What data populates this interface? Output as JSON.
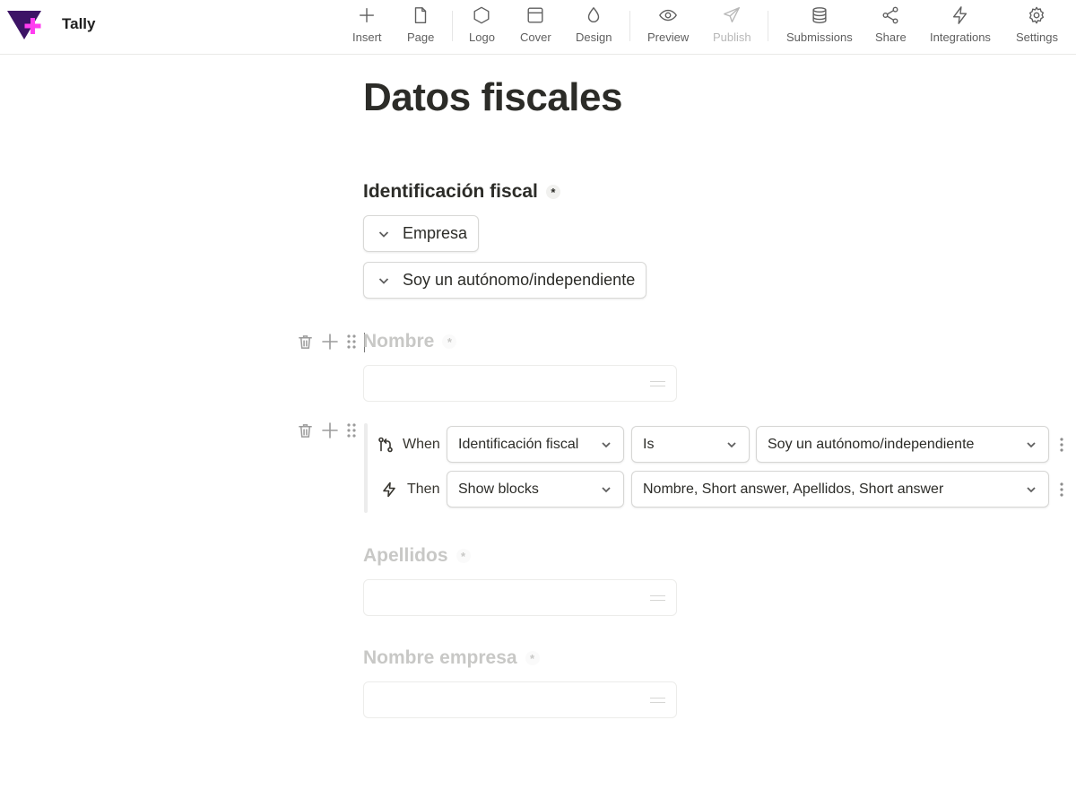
{
  "app": {
    "name": "Tally",
    "logo_colors": {
      "triangle": "#3d1466",
      "plus": "#ff3df0"
    }
  },
  "toolbar": {
    "items": [
      {
        "label": "Insert",
        "icon": "plus-icon"
      },
      {
        "label": "Page",
        "icon": "page-icon"
      },
      {
        "label": "Logo",
        "icon": "hexagon-icon"
      },
      {
        "label": "Cover",
        "icon": "cover-icon"
      },
      {
        "label": "Design",
        "icon": "droplet-icon"
      },
      {
        "label": "Preview",
        "icon": "eye-icon"
      },
      {
        "label": "Publish",
        "icon": "send-icon",
        "disabled": true
      },
      {
        "label": "Submissions",
        "icon": "database-icon"
      },
      {
        "label": "Share",
        "icon": "share-icon"
      },
      {
        "label": "Integrations",
        "icon": "lightning-icon"
      },
      {
        "label": "Settings",
        "icon": "gear-icon"
      }
    ]
  },
  "form": {
    "title": "Datos fiscales",
    "fiscal_question": {
      "label": "Identificación fiscal",
      "required_mark": "*",
      "options": [
        "Empresa",
        "Soy un autónomo/independiente"
      ]
    },
    "nombre": {
      "label": "Nombre",
      "required_mark": "*"
    },
    "logic": {
      "when_label": "When",
      "then_label": "Then",
      "when_field": "Identificación fiscal",
      "when_operator": "Is",
      "when_value": "Soy un autónomo/independiente",
      "then_action": "Show blocks",
      "then_targets": "Nombre, Short answer, Apellidos, Short answer"
    },
    "apellidos": {
      "label": "Apellidos",
      "required_mark": "*"
    },
    "nombre_empresa": {
      "label": "Nombre empresa",
      "required_mark": "*"
    }
  }
}
